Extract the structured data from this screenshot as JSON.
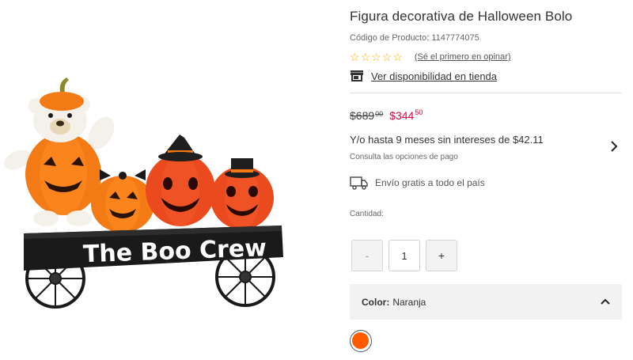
{
  "product": {
    "title": "Figura decorativa de Halloween Bolo",
    "code_text": "Código de Producto: 1147774075",
    "image_alt": "The Boo Crew",
    "rating": {
      "stars": 5,
      "filled": 0,
      "review_link": "(Sé el primero en opinar)"
    },
    "store_link": "Ver disponibilidad en tienda"
  },
  "price": {
    "old_whole": "$689",
    "old_cents": "00",
    "new_whole": "$344",
    "new_cents": "50"
  },
  "payment": {
    "installments": "Y/o hasta 9 meses sin intereses de $42.11",
    "options_link": "Consulta las opciones de pago"
  },
  "shipping": {
    "text": "Envío gratis a todo el país"
  },
  "quantity": {
    "label": "Cantidad:",
    "value": "1",
    "minus": "-",
    "plus": "+"
  },
  "color": {
    "label": "Color:",
    "value": "Naranja",
    "swatch_hex": "#ff5a00"
  },
  "icons": [
    "store-icon",
    "truck-icon",
    "chevron-right-icon",
    "chevron-up-icon",
    "star-icon"
  ]
}
